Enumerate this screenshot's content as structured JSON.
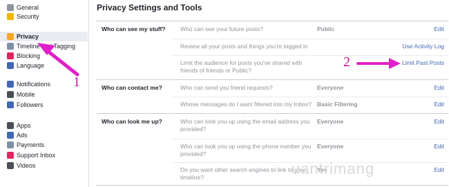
{
  "sidebar": {
    "groups": [
      [
        {
          "label": "General",
          "icon": "gear-icon",
          "color": "#8d949e"
        },
        {
          "label": "Security",
          "icon": "shield-icon",
          "color": "#f0b400"
        }
      ],
      [
        {
          "label": "Privacy",
          "icon": "privacy-lock-icon",
          "color": "#f5a623",
          "active": true
        },
        {
          "label": "Timeline and Tagging",
          "icon": "timeline-icon",
          "color": "#7f8fa6"
        },
        {
          "label": "Blocking",
          "icon": "blocking-icon",
          "color": "#e0245e"
        },
        {
          "label": "Language",
          "icon": "globe-icon",
          "color": "#4267b2"
        }
      ],
      [
        {
          "label": "Notifications",
          "icon": "globe-notification-icon",
          "color": "#4267b2"
        },
        {
          "label": "Mobile",
          "icon": "mobile-icon",
          "color": "#4b4f56"
        },
        {
          "label": "Followers",
          "icon": "followers-icon",
          "color": "#4267b2"
        }
      ],
      [
        {
          "label": "Apps",
          "icon": "apps-icon",
          "color": "#4b4f56"
        },
        {
          "label": "Ads",
          "icon": "ads-icon",
          "color": "#4267b2"
        },
        {
          "label": "Payments",
          "icon": "payments-icon",
          "color": "#7f8fa6"
        },
        {
          "label": "Support Inbox",
          "icon": "support-icon",
          "color": "#e0245e"
        },
        {
          "label": "Videos",
          "icon": "videos-icon",
          "color": "#4b4f56"
        }
      ]
    ]
  },
  "main": {
    "title": "Privacy Settings and Tools",
    "sections": [
      {
        "label": "Who can see my stuff?",
        "rows": [
          {
            "question": "Who can see your future posts?",
            "value": "Public",
            "action": "Edit"
          },
          {
            "question": "Review all your posts and things you're tagged in",
            "value": "",
            "action": "Use Activity Log"
          },
          {
            "question": "Limit the audience for posts you've shared with friends of friends or Public?",
            "value": "",
            "action": "Limit Past Posts"
          }
        ]
      },
      {
        "label": "Who can contact me?",
        "rows": [
          {
            "question": "Who can send you friend requests?",
            "value": "Everyone",
            "action": "Edit"
          },
          {
            "question": "Whose messages do I want filtered into my Inbox?",
            "value": "Basic Filtering",
            "action": "Edit"
          }
        ]
      },
      {
        "label": "Who can look me up?",
        "rows": [
          {
            "question": "Who can look you up using the email address you provided?",
            "value": "Everyone",
            "action": "Edit"
          },
          {
            "question": "Who can look you up using the phone number you provided?",
            "value": "Everyone",
            "action": "Edit"
          },
          {
            "question": "Do you want other search engines to link to your timeline?",
            "value": "Yes",
            "action": "Edit"
          }
        ]
      }
    ]
  },
  "annotations": {
    "num1": "1",
    "num2": "2",
    "color": "#e020c8"
  },
  "watermark": "uantrimang"
}
